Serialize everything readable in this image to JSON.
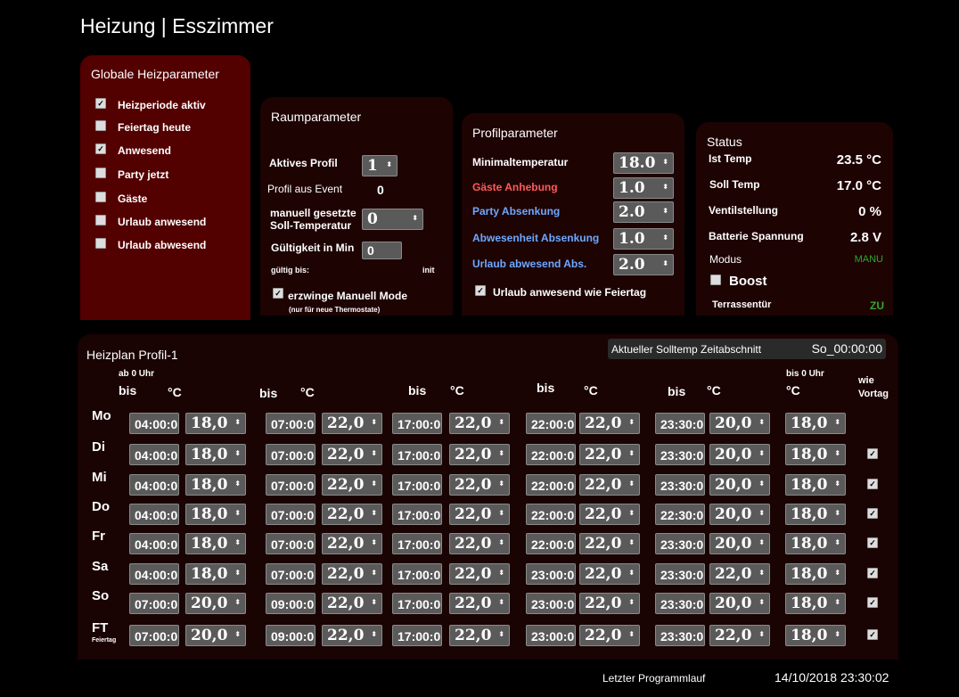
{
  "header": {
    "title": "Heizung | Esszimmer"
  },
  "global": {
    "title": "Globale Heizparameter",
    "items": [
      {
        "label": "Heizperiode aktiv",
        "checked": true
      },
      {
        "label": "Feiertag heute",
        "checked": false
      },
      {
        "label": "Anwesend",
        "checked": true
      },
      {
        "label": "Party jetzt",
        "checked": false
      },
      {
        "label": "Gäste",
        "checked": false
      },
      {
        "label": "Urlaub anwesend",
        "checked": false
      },
      {
        "label": "Urlaub abwesend",
        "checked": false
      }
    ]
  },
  "room": {
    "title": "Raumparameter",
    "active_profile_label": "Aktives Profil",
    "active_profile_value": "1",
    "profile_event_label": "Profil aus Event",
    "profile_event_value": "0",
    "manual_label_1": "manuell gesetzte",
    "manual_label_2": "Soll-Temperatur",
    "manual_value": "0",
    "valid_label": "Gültigkeit in Min",
    "valid_value": "0",
    "valid_until_label": "gültig bis:",
    "valid_until_value": "init",
    "force_manual_label": "erzwinge Manuell Mode",
    "force_manual_note": "(nur für neue Thermostate)"
  },
  "profile": {
    "title": "Profilparameter",
    "rows": [
      {
        "label": "Minimaltemperatur",
        "value": "18.0",
        "color": "#ffffff"
      },
      {
        "label": "Gäste Anhebung",
        "value": "1.0",
        "color": "#ff5a5a"
      },
      {
        "label": "Party Absenkung",
        "value": "2.0",
        "color": "#6ea8ff"
      },
      {
        "label": "Abwesenheit Absenkung",
        "value": "1.0",
        "color": "#6ea8ff"
      },
      {
        "label": "Urlaub abwesend Abs.",
        "value": "2.0",
        "color": "#6ea8ff"
      }
    ],
    "holiday_label": "Urlaub anwesend wie Feiertag"
  },
  "status": {
    "title": "Status",
    "ist_label": "Ist Temp",
    "ist_value": "23.5 °C",
    "soll_label": "Soll Temp",
    "soll_value": "17.0 °C",
    "ventil_label": "Ventilstellung",
    "ventil_value": "0 %",
    "batt_label": "Batterie Spannung",
    "batt_value": "2.8 V",
    "modus_label": "Modus",
    "modus_value": "MANU",
    "boost_label": "Boost",
    "tuer_label": "Terrassentür",
    "tuer_value": "ZU",
    "accent_green": "#2ea82e"
  },
  "plan": {
    "title": "Heizplan Profil-1",
    "current_label": "Aktueller Solltemp Zeitabschnitt",
    "current_value": "So_00:00:00",
    "headers": {
      "ab0": "ab 0 Uhr",
      "bis": "bis",
      "deg": "°C",
      "bis0": "bis 0 Uhr",
      "wie1": "wie",
      "wie2": "Vortag"
    },
    "rows": [
      {
        "day": "Mo",
        "sub": "",
        "t": [
          "04:00:0",
          "07:00:0",
          "17:00:0",
          "22:00:0",
          "23:30:0"
        ],
        "v": [
          "18,0",
          "22,0",
          "22,0",
          "22,0",
          "20,0",
          "18,0"
        ],
        "wie": null
      },
      {
        "day": "Di",
        "sub": "",
        "t": [
          "04:00:0",
          "07:00:0",
          "17:00:0",
          "22:00:0",
          "23:30:0"
        ],
        "v": [
          "18,0",
          "22,0",
          "22,0",
          "22,0",
          "20,0",
          "18,0"
        ],
        "wie": true
      },
      {
        "day": "Mi",
        "sub": "",
        "t": [
          "04:00:0",
          "07:00:0",
          "17:00:0",
          "22:00:0",
          "23:30:0"
        ],
        "v": [
          "18,0",
          "22,0",
          "22,0",
          "22,0",
          "20,0",
          "18,0"
        ],
        "wie": true
      },
      {
        "day": "Do",
        "sub": "",
        "t": [
          "04:00:0",
          "07:00:0",
          "17:00:0",
          "22:00:0",
          "22:30:0"
        ],
        "v": [
          "18,0",
          "22,0",
          "22,0",
          "22,0",
          "20,0",
          "18,0"
        ],
        "wie": true
      },
      {
        "day": "Fr",
        "sub": "",
        "t": [
          "04:00:0",
          "07:00:0",
          "17:00:0",
          "22:00:0",
          "23:30:0"
        ],
        "v": [
          "18,0",
          "22,0",
          "22,0",
          "22,0",
          "20,0",
          "18,0"
        ],
        "wie": true
      },
      {
        "day": "Sa",
        "sub": "",
        "t": [
          "04:00:0",
          "07:00:0",
          "17:00:0",
          "23:00:0",
          "23:30:0"
        ],
        "v": [
          "18,0",
          "22,0",
          "22,0",
          "22,0",
          "22,0",
          "18,0"
        ],
        "wie": true
      },
      {
        "day": "So",
        "sub": "",
        "t": [
          "07:00:0",
          "09:00:0",
          "17:00:0",
          "23:00:0",
          "23:30:0"
        ],
        "v": [
          "20,0",
          "22,0",
          "22,0",
          "22,0",
          "20,0",
          "18,0"
        ],
        "wie": true
      },
      {
        "day": "FT",
        "sub": "Feiertag",
        "t": [
          "07:00:0",
          "09:00:0",
          "17:00:0",
          "23:00:0",
          "23:30:0"
        ],
        "v": [
          "20,0",
          "22,0",
          "22,0",
          "22,0",
          "22,0",
          "18,0"
        ],
        "wie": true
      }
    ]
  },
  "footer": {
    "last_run_label": "Letzter Programmlauf",
    "last_run_value": "14/10/2018 23:30:02"
  },
  "colors": {
    "global_bg": "#530000",
    "panel_bg": "#1e0303",
    "plan_bg": "#1a0303"
  }
}
